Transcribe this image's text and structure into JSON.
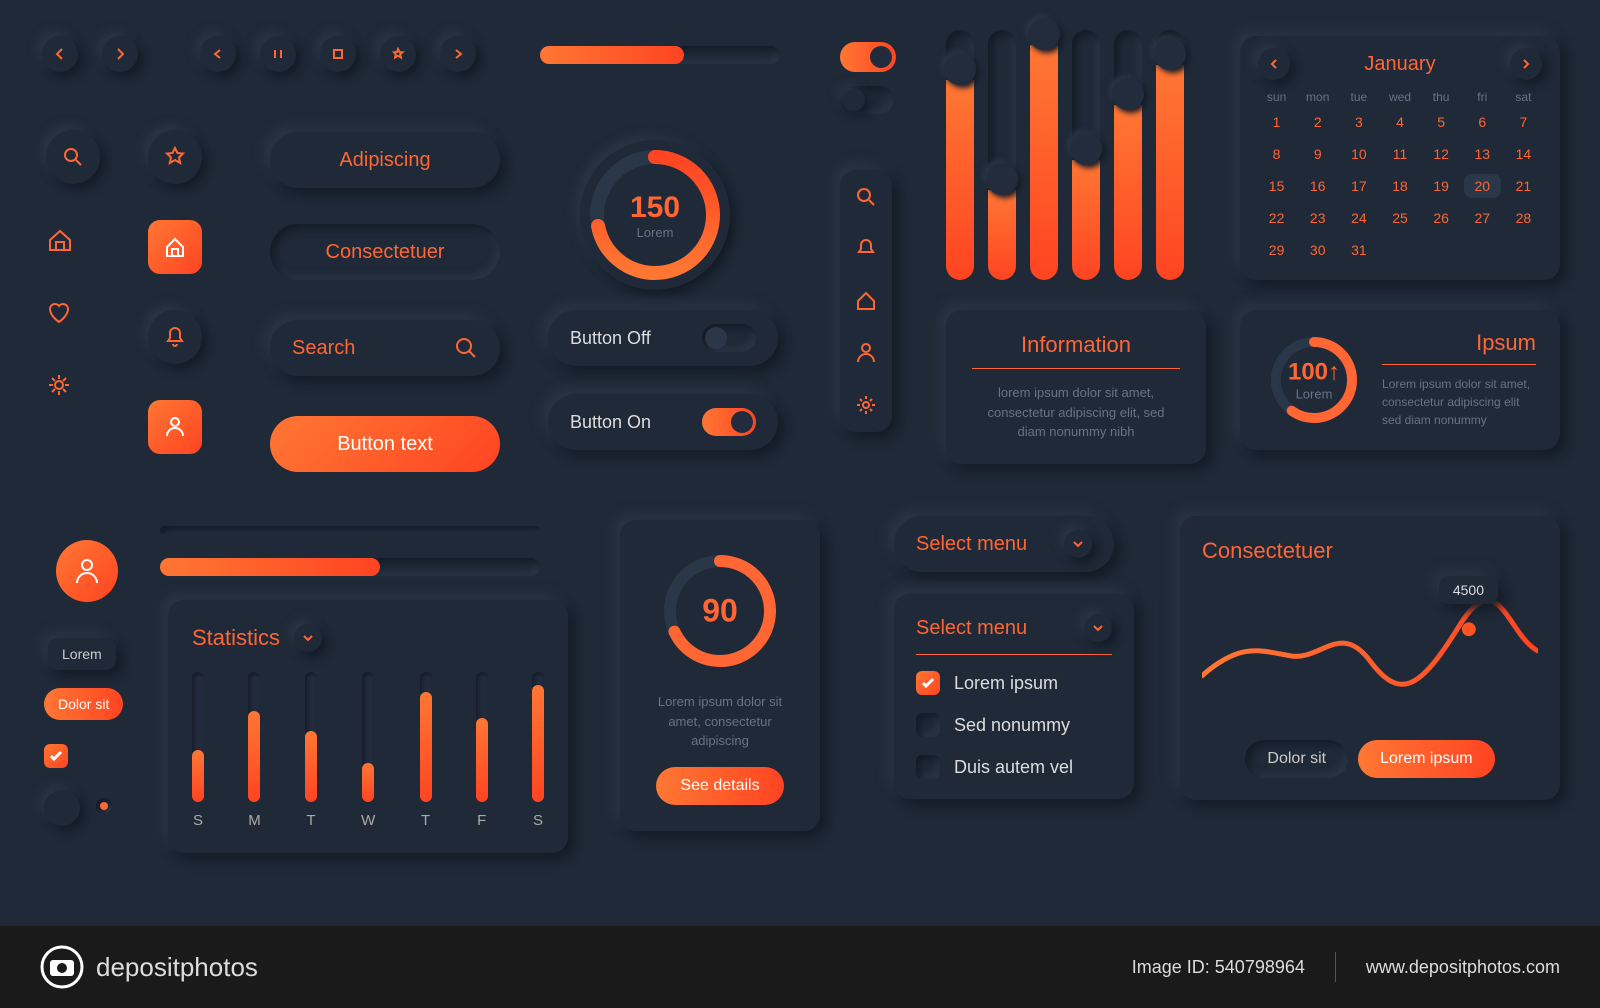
{
  "buttons": {
    "adipiscing": "Adipiscing",
    "consectetuer": "Consectetuer",
    "search_placeholder": "Search",
    "button_text": "Button text",
    "button_off": "Button Off",
    "button_on": "Button On",
    "see_details": "See details"
  },
  "dial1": {
    "value": "150",
    "sub": "Lorem"
  },
  "dial2": {
    "value": "90",
    "desc": "Lorem ipsum dolor sit amet, consectetur adipiscing"
  },
  "info_card": {
    "title": "Information",
    "body": "lorem ipsum dolor sit amet, consectetur adipiscing elit, sed diam nonummy nibh"
  },
  "ipsum_card": {
    "title": "Ipsum",
    "value": "100",
    "sub": "Lorem",
    "body": "Lorem ipsum dolor sit amet, consectetur adipiscing elit sed diam nonummy"
  },
  "stats": {
    "title": "Statistics",
    "days": [
      "S",
      "M",
      "T",
      "W",
      "T",
      "F",
      "S"
    ]
  },
  "menu": {
    "select1": "Select menu",
    "select2": "Select menu",
    "options": [
      "Lorem ipsum",
      "Sed nonummy",
      "Duis autem vel"
    ]
  },
  "line_card": {
    "title": "Consectetuer",
    "tooltip": "4500",
    "pill1": "Dolor sit",
    "pill2": "Lorem ipsum"
  },
  "tags": {
    "lorem": "Lorem",
    "dolor_sit": "Dolor sit"
  },
  "calendar": {
    "month": "January",
    "dow": [
      "sun",
      "mon",
      "tue",
      "wed",
      "thu",
      "fri",
      "sat"
    ],
    "days": [
      "1",
      "2",
      "3",
      "4",
      "5",
      "6",
      "7",
      "8",
      "9",
      "10",
      "11",
      "12",
      "13",
      "14",
      "15",
      "16",
      "17",
      "18",
      "19",
      "20",
      "21",
      "22",
      "23",
      "24",
      "25",
      "26",
      "27",
      "28",
      "29",
      "30",
      "31"
    ]
  },
  "footer": {
    "brand": "depositphotos",
    "image_id_label": "Image ID:",
    "image_id": "540798964",
    "url": "www.depositphotos.com"
  },
  "chart_data": [
    {
      "type": "bar",
      "title": "Equalizer",
      "categories": [
        "1",
        "2",
        "3",
        "4",
        "5",
        "6"
      ],
      "values": [
        80,
        36,
        94,
        48,
        70,
        86
      ],
      "ylim": [
        0,
        100
      ]
    },
    {
      "type": "bar",
      "title": "Statistics weekly",
      "categories": [
        "S",
        "M",
        "T",
        "W",
        "T",
        "F",
        "S"
      ],
      "values": [
        40,
        70,
        55,
        30,
        85,
        65,
        90
      ],
      "ylim": [
        0,
        100
      ]
    },
    {
      "type": "line",
      "title": "Consectetuer",
      "x": [
        0,
        1,
        2,
        3,
        4,
        5,
        6,
        7
      ],
      "values": [
        3200,
        3900,
        3700,
        4400,
        3500,
        4100,
        4500,
        4200
      ],
      "tooltip_index": 6,
      "ylim": [
        3000,
        5000
      ]
    },
    {
      "type": "pie",
      "title": "Dial 150",
      "values": [
        72,
        28
      ]
    },
    {
      "type": "pie",
      "title": "Dial 90",
      "values": [
        68,
        32
      ]
    },
    {
      "type": "pie",
      "title": "Dial 100",
      "values": [
        60,
        40
      ]
    }
  ]
}
